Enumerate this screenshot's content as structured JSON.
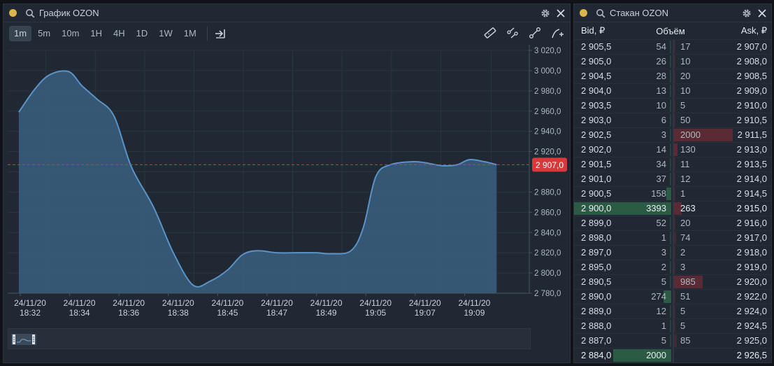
{
  "chart_panel": {
    "title": "График OZON"
  },
  "timeframes": [
    "1m",
    "5m",
    "10m",
    "1H",
    "4H",
    "1D",
    "1W",
    "1M"
  ],
  "active_timeframe": "1m",
  "book_panel": {
    "title": "Стакан OZON",
    "headers": {
      "bid": "Bid, ₽",
      "volume": "Объём",
      "ask": "Ask, ₽"
    },
    "rows": [
      {
        "bid": "2 905,5",
        "bid_vol": "54",
        "ask_vol": "17",
        "ask": "2 907,0"
      },
      {
        "bid": "2 905,0",
        "bid_vol": "26",
        "ask_vol": "10",
        "ask": "2 908,0"
      },
      {
        "bid": "2 904,5",
        "bid_vol": "28",
        "ask_vol": "20",
        "ask": "2 908,5"
      },
      {
        "bid": "2 904,0",
        "bid_vol": "13",
        "ask_vol": "10",
        "ask": "2 909,0"
      },
      {
        "bid": "2 903,5",
        "bid_vol": "10",
        "ask_vol": "5",
        "ask": "2 910,0"
      },
      {
        "bid": "2 903,0",
        "bid_vol": "6",
        "ask_vol": "50",
        "ask": "2 910,5"
      },
      {
        "bid": "2 902,5",
        "bid_vol": "3",
        "ask_vol": "2000",
        "ask": "2 911,5"
      },
      {
        "bid": "2 902,0",
        "bid_vol": "14",
        "ask_vol": "130",
        "ask": "2 913,0"
      },
      {
        "bid": "2 901,5",
        "bid_vol": "34",
        "ask_vol": "11",
        "ask": "2 913,5"
      },
      {
        "bid": "2 901,0",
        "bid_vol": "37",
        "ask_vol": "12",
        "ask": "2 914,0"
      },
      {
        "bid": "2 900,5",
        "bid_vol": "158",
        "ask_vol": "1",
        "ask": "2 914,5"
      },
      {
        "bid": "2 900,0",
        "bid_vol": "3393",
        "ask_vol": "263",
        "ask": "2 915,0"
      },
      {
        "bid": "2 899,0",
        "bid_vol": "52",
        "ask_vol": "20",
        "ask": "2 916,0"
      },
      {
        "bid": "2 898,0",
        "bid_vol": "1",
        "ask_vol": "74",
        "ask": "2 917,0"
      },
      {
        "bid": "2 897,0",
        "bid_vol": "3",
        "ask_vol": "2",
        "ask": "2 918,0"
      },
      {
        "bid": "2 895,0",
        "bid_vol": "2",
        "ask_vol": "3",
        "ask": "2 919,0"
      },
      {
        "bid": "2 890,5",
        "bid_vol": "5",
        "ask_vol": "985",
        "ask": "2 920,0"
      },
      {
        "bid": "2 890,0",
        "bid_vol": "274",
        "ask_vol": "51",
        "ask": "2 922,0"
      },
      {
        "bid": "2 889,0",
        "bid_vol": "12",
        "ask_vol": "5",
        "ask": "2 924,0"
      },
      {
        "bid": "2 888,0",
        "bid_vol": "1",
        "ask_vol": "5",
        "ask": "2 924,5"
      },
      {
        "bid": "2 887,0",
        "bid_vol": "5",
        "ask_vol": "85",
        "ask": "2 925,0"
      },
      {
        "bid": "2 884,0",
        "bid_vol": "2000",
        "ask_vol": "",
        "ask": "2 926,5"
      }
    ]
  },
  "colors": {
    "line": "#5b93c7",
    "fill": "#3a5f80",
    "last_price": "#d9393b",
    "bid_bar": "#2b5a45",
    "ask_bar": "#5a2a35"
  },
  "chart_data": {
    "type": "area",
    "x_categories": [
      "24/11/20 18:32",
      "24/11/20 18:34",
      "24/11/20 18:36",
      "24/11/20 18:38",
      "24/11/20 18:45",
      "24/11/20 18:47",
      "24/11/20 18:49",
      "24/11/20 19:05",
      "24/11/20 19:07",
      "24/11/20 19:09"
    ],
    "y_ticks": [
      "2 780,0",
      "2 800,0",
      "2 820,0",
      "2 840,0",
      "2 860,0",
      "2 880,0",
      "2 900,0",
      "2 920,0",
      "2 940,0",
      "2 960,0",
      "2 980,0",
      "3 000,0",
      "3 020,0"
    ],
    "ylim": [
      2780,
      3020
    ],
    "x_range": [
      -0.03,
      9.65
    ],
    "series": [
      {
        "points": [
          [
            -0.03,
            2959
          ],
          [
            0.3,
            2982
          ],
          [
            0.6,
            2996
          ],
          [
            0.98,
            2999
          ],
          [
            1.25,
            2985
          ],
          [
            1.55,
            2972
          ],
          [
            1.9,
            2955
          ],
          [
            2.25,
            2905
          ],
          [
            2.7,
            2865
          ],
          [
            3.1,
            2820
          ],
          [
            3.5,
            2788
          ],
          [
            3.85,
            2792
          ],
          [
            4.2,
            2803
          ],
          [
            4.5,
            2818
          ],
          [
            4.8,
            2822
          ],
          [
            5.2,
            2820
          ],
          [
            5.6,
            2820
          ],
          [
            6.0,
            2820
          ],
          [
            6.3,
            2819
          ],
          [
            6.7,
            2822
          ],
          [
            6.95,
            2845
          ],
          [
            7.2,
            2895
          ],
          [
            7.5,
            2907
          ],
          [
            7.95,
            2910
          ],
          [
            8.2,
            2909
          ],
          [
            8.55,
            2906
          ],
          [
            8.85,
            2907
          ],
          [
            9.1,
            2912
          ],
          [
            9.4,
            2910
          ],
          [
            9.65,
            2907
          ]
        ]
      }
    ],
    "last_price": 2907.0,
    "last_price_label": "2 907,0",
    "grid": true
  }
}
